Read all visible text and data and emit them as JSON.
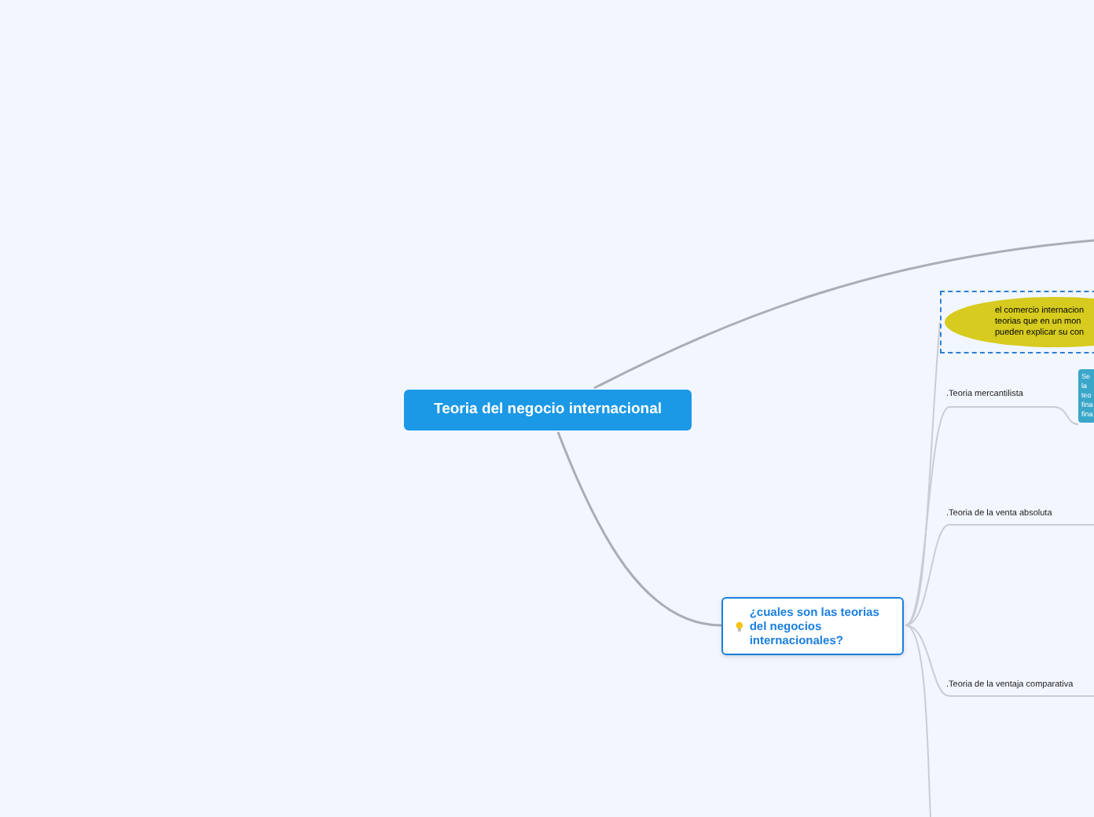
{
  "central_topic": {
    "title": "Teoria del negocio internacional"
  },
  "main_topic": {
    "title": "¿cuales son las teorias del negocios internacionales?"
  },
  "callout": {
    "lines": [
      "el comercio internacion",
      "teorias que en un mon",
      "pueden explicar su con"
    ]
  },
  "branches": [
    {
      "label": ".Teoria mercantilista"
    },
    {
      "label": ".Teoria de la venta absoluta"
    },
    {
      "label": ".Teoria de la ventaja comparativa"
    }
  ],
  "note_box": {
    "lines": [
      "Se",
      "la",
      "teo",
      "fina",
      "fina"
    ]
  }
}
